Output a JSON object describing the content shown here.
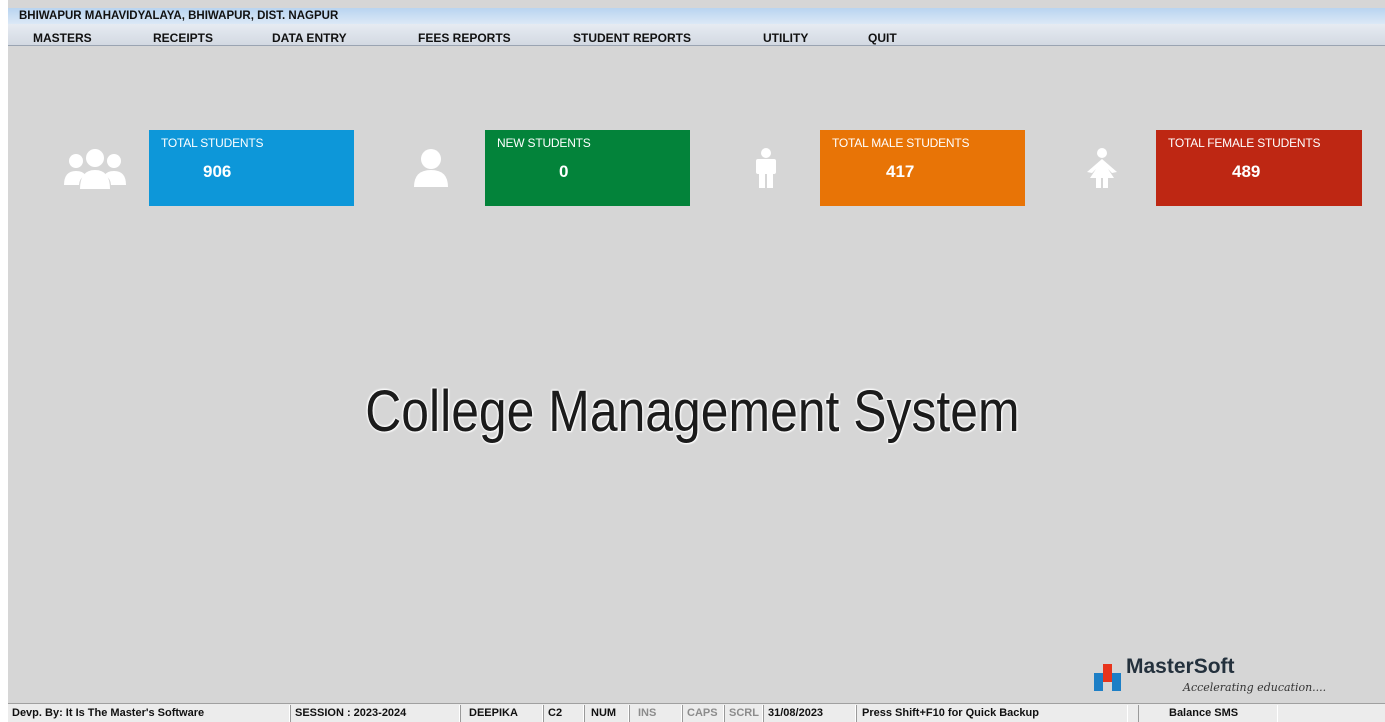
{
  "window": {
    "title": "BHIWAPUR MAHAVIDYALAYA, BHIWAPUR, DIST. NAGPUR"
  },
  "menu": [
    "MASTERS",
    "RECEIPTS",
    "DATA ENTRY",
    "FEES REPORTS",
    "STUDENT REPORTS",
    "UTILITY",
    "QUIT"
  ],
  "tiles": [
    {
      "label": "TOTAL STUDENTS",
      "value": "906",
      "icon": "users-group-icon",
      "color": "#0d97d9",
      "icon_bg": "#0b6f9e"
    },
    {
      "label": "NEW STUDENTS",
      "value": "0",
      "icon": "user-icon",
      "color": "#03833a",
      "icon_bg": "#04632c"
    },
    {
      "label": "TOTAL MALE STUDENTS",
      "value": "417",
      "icon": "male-icon",
      "color": "#e87406",
      "icon_bg": "#a55606"
    },
    {
      "label": "TOTAL FEMALE STUDENTS",
      "value": "489",
      "icon": "female-icon",
      "color": "#be2713",
      "icon_bg": "#8a1a0d"
    }
  ],
  "headline": "College Management System",
  "logo": {
    "brand": "MasterSoft",
    "tagline": "Accelerating education....",
    "colors": [
      "#e8341c",
      "#1d7fc6"
    ]
  },
  "status": {
    "developer": "Devp. By: It Is The Master's Software",
    "session": "SESSION : 2023-2024",
    "user": "DEEPIKA",
    "code": "C2",
    "num": "NUM",
    "ins": "INS",
    "caps": "CAPS",
    "scrl": "SCRL",
    "date": "31/08/2023",
    "backup_hint": "Press Shift+F10 for Quick Backup",
    "sms": "Balance SMS"
  }
}
